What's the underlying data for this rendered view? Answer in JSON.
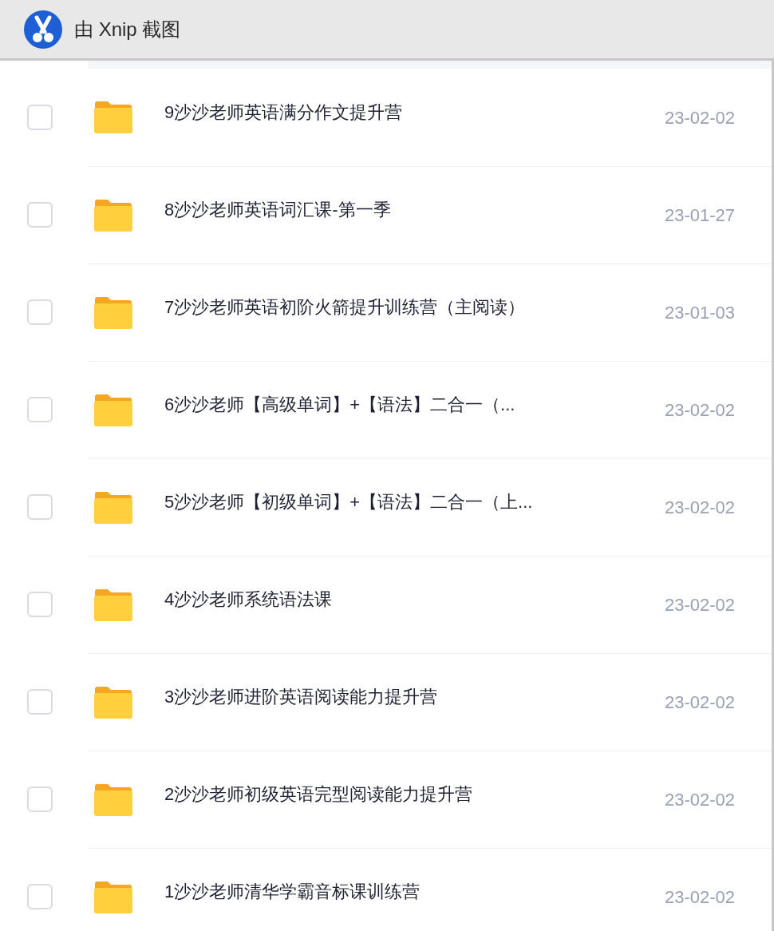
{
  "title_bar": {
    "title": "由 Xnip 截图"
  },
  "files": [
    {
      "name": "9沙沙老师英语满分作文提升营",
      "date": "23-02-02",
      "checked": false
    },
    {
      "name": "8沙沙老师英语词汇课-第一季",
      "date": "23-01-27",
      "checked": false
    },
    {
      "name": "7沙沙老师英语初阶火箭提升训练营（主阅读）",
      "date": "23-01-03",
      "checked": false
    },
    {
      "name": "6沙沙老师【高级单词】+【语法】二合一（...",
      "date": "23-02-02",
      "checked": false
    },
    {
      "name": "5沙沙老师【初级单词】+【语法】二合一（上...",
      "date": "23-02-02",
      "checked": false
    },
    {
      "name": "4沙沙老师系统语法课",
      "date": "23-02-02",
      "checked": false
    },
    {
      "name": "3沙沙老师进阶英语阅读能力提升营",
      "date": "23-02-02",
      "checked": false
    },
    {
      "name": "2沙沙老师初级英语完型阅读能力提升营",
      "date": "23-02-02",
      "checked": false
    },
    {
      "name": "1沙沙老师清华学霸音标课训练营",
      "date": "23-02-02",
      "checked": false
    }
  ]
}
